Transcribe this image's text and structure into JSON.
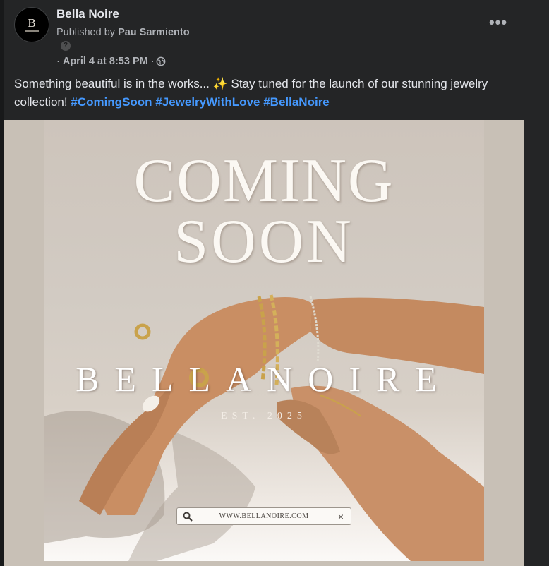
{
  "post": {
    "page_name": "Bella Noire",
    "published_by_prefix": "Published by",
    "published_by_name": "Pau Sarmiento",
    "help_glyph": "?",
    "meta_prefix": "·",
    "date": "April 4 at 8:53 PM",
    "meta_sep": "·",
    "audience_icon": "globe-icon",
    "more_glyph": "•••",
    "caption_text": "Something beautiful is in the works... ✨ Stay tuned for the launch of our stunning jewelry collection!",
    "hashtags": [
      "#ComingSoon",
      "#JewelryWithLove",
      "#BellaNoire"
    ],
    "avatar_glyph": "B"
  },
  "image": {
    "headline_line1": "COMING",
    "headline_line2": "SOON",
    "brand": "BELLANOIRE",
    "est": "EST. 2025",
    "url": "WWW.BELLANOIRE.COM",
    "close_glyph": "×",
    "search_icon": "search-icon"
  },
  "colors": {
    "background": "#18191a",
    "card": "#242526",
    "text": "#e4e6eb",
    "secondary_text": "#b0b3b8",
    "hashtag": "#4599ff"
  }
}
